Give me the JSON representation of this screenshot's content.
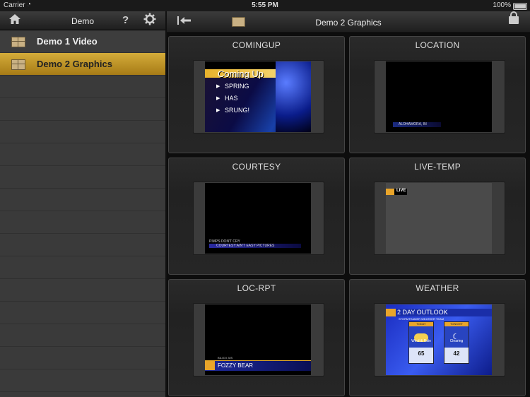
{
  "status_bar": {
    "carrier": "Carrier",
    "time": "5:55 PM",
    "battery": "100%"
  },
  "sidebar": {
    "title": "Demo",
    "items": [
      {
        "label": "Demo 1 Video",
        "selected": false
      },
      {
        "label": "Demo 2 Graphics",
        "selected": true
      }
    ]
  },
  "main": {
    "title": "Demo 2 Graphics",
    "tiles": [
      {
        "label": "COMINGUP"
      },
      {
        "label": "LOCATION"
      },
      {
        "label": "COURTESY"
      },
      {
        "label": "LIVE-TEMP"
      },
      {
        "label": "LOC-RPT"
      },
      {
        "label": "WEATHER"
      }
    ]
  },
  "previews": {
    "comingup": {
      "title": "Coming Up",
      "items": [
        "SPRING",
        "HAS",
        "SRUNG!"
      ]
    },
    "location": {
      "text": "ALOHAMORA, IN"
    },
    "courtesy": {
      "line1": "PIMPS DON'T CRY",
      "line2": "COURTESY:AIN'T EASY PICTURES"
    },
    "live_temp": {
      "text": "LIVE"
    },
    "loc_rpt": {
      "location": "BILOXI, MS",
      "name": "FOZZY BEAR"
    },
    "weather": {
      "title": "2 DAY OUTLOOK",
      "subtitle": "STORMTEAMER WEATHER TEAM",
      "today": {
        "label": "TODAY",
        "desc": "Wind & Rain",
        "temp": "65"
      },
      "tonight": {
        "label": "TONIGHT",
        "desc": "Clearing",
        "temp": "42"
      }
    }
  },
  "colors": {
    "selection_gold": "#c9a23a",
    "accent_orange": "#e9a52a",
    "graphic_blue": "#1f2a9a"
  }
}
